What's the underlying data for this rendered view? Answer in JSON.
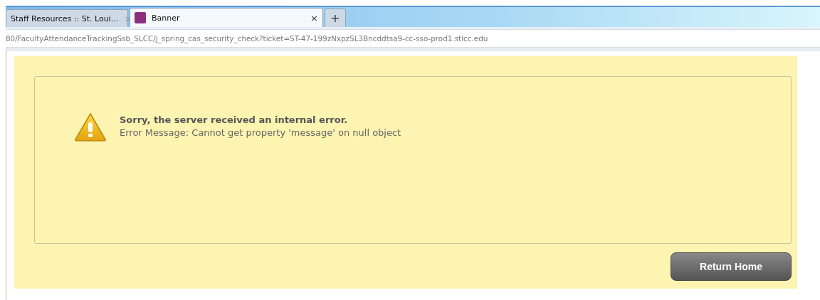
{
  "tabs": [
    {
      "label": "Staff Resources :: St. Loui...",
      "close": "×",
      "selected": false
    },
    {
      "label": "Banner",
      "close": "×",
      "selected": true
    }
  ],
  "new_tab": "+",
  "address": "80/FacultyAttendanceTrackingSsb_SLCC/j_spring_cas_security_check?ticket=ST-47-199zNxpzSL3Bncddtsa9-cc-sso-prod1.stlcc.edu",
  "error": {
    "title": "Sorry, the server received an internal error.",
    "message": "Error Message: Cannot get property 'message' on null object"
  },
  "button": "Return Home"
}
